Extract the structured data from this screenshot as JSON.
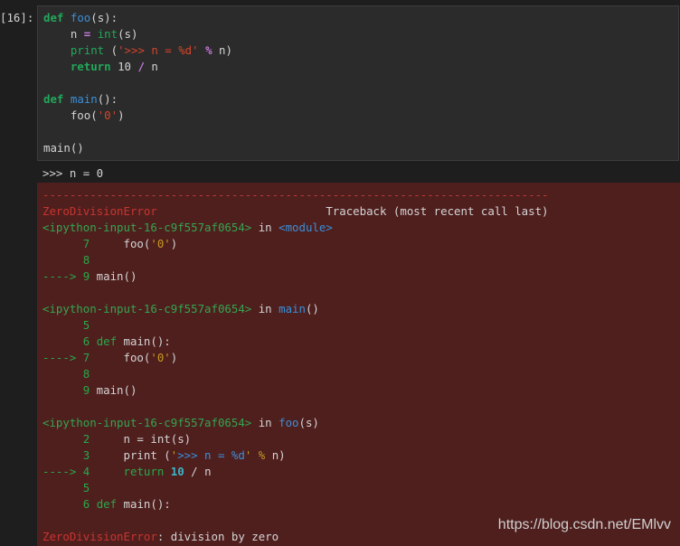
{
  "cell": {
    "prompt": "[16]:",
    "code": [
      [
        [
          "kw",
          "def"
        ],
        [
          "nm",
          " "
        ],
        [
          "fn",
          "foo"
        ],
        [
          "nm",
          "(s):"
        ]
      ],
      [
        [
          "nm",
          "    n "
        ],
        [
          "op",
          "="
        ],
        [
          "nm",
          " "
        ],
        [
          "bi",
          "int"
        ],
        [
          "nm",
          "(s)"
        ]
      ],
      [
        [
          "nm",
          "    "
        ],
        [
          "bi",
          "print"
        ],
        [
          "nm",
          " ("
        ],
        [
          "str",
          "'>>> n = "
        ],
        [
          "fmt",
          "%d"
        ],
        [
          "str",
          "'"
        ],
        [
          "nm",
          " "
        ],
        [
          "op",
          "%"
        ],
        [
          "nm",
          " n)"
        ]
      ],
      [
        [
          "nm",
          "    "
        ],
        [
          "kw",
          "return"
        ],
        [
          "nm",
          " "
        ],
        [
          "num",
          "10"
        ],
        [
          "nm",
          " "
        ],
        [
          "op",
          "/"
        ],
        [
          "nm",
          " n"
        ]
      ],
      [
        [
          "nm",
          ""
        ]
      ],
      [
        [
          "kw",
          "def"
        ],
        [
          "nm",
          " "
        ],
        [
          "fn",
          "main"
        ],
        [
          "nm",
          "():"
        ]
      ],
      [
        [
          "nm",
          "    foo("
        ],
        [
          "str",
          "'0'"
        ],
        [
          "nm",
          ")"
        ]
      ],
      [
        [
          "nm",
          ""
        ]
      ],
      [
        [
          "nm",
          "main()"
        ]
      ]
    ]
  },
  "stdout": ">>> n = 0",
  "traceback": {
    "lines": [
      [
        [
          "dash",
          "---------------------------------------------------------------------------"
        ]
      ],
      [
        [
          "err",
          "ZeroDivisionError"
        ],
        [
          "nm",
          "                         Traceback (most recent call last)"
        ]
      ],
      [
        [
          "grn",
          "<ipython-input-16-c9f557af0654>"
        ],
        [
          "nm",
          " in "
        ],
        [
          "cyn",
          "<module>"
        ]
      ],
      [
        [
          "lno",
          "      7"
        ],
        [
          "nm",
          "     foo("
        ],
        [
          "tbstr",
          "'0'"
        ],
        [
          "nm",
          ")"
        ]
      ],
      [
        [
          "lno",
          "      8"
        ]
      ],
      [
        [
          "arrow",
          "----> 9"
        ],
        [
          "nm",
          " main()"
        ]
      ],
      [
        [
          "nm",
          ""
        ]
      ],
      [
        [
          "grn",
          "<ipython-input-16-c9f557af0654>"
        ],
        [
          "nm",
          " in "
        ],
        [
          "cyn",
          "main"
        ],
        [
          "nm",
          "()"
        ]
      ],
      [
        [
          "lno",
          "      5"
        ]
      ],
      [
        [
          "lno",
          "      6"
        ],
        [
          "nm",
          " "
        ],
        [
          "tbkw",
          "def"
        ],
        [
          "nm",
          " main():"
        ]
      ],
      [
        [
          "arrow",
          "----> 7"
        ],
        [
          "nm",
          "     foo("
        ],
        [
          "tbstr",
          "'0'"
        ],
        [
          "nm",
          ")"
        ]
      ],
      [
        [
          "lno",
          "      8"
        ]
      ],
      [
        [
          "lno",
          "      9"
        ],
        [
          "nm",
          " main()"
        ]
      ],
      [
        [
          "nm",
          ""
        ]
      ],
      [
        [
          "grn",
          "<ipython-input-16-c9f557af0654>"
        ],
        [
          "nm",
          " in "
        ],
        [
          "cyn",
          "foo"
        ],
        [
          "nm",
          "(s)"
        ]
      ],
      [
        [
          "lno",
          "      2"
        ],
        [
          "nm",
          "     n = int(s)"
        ]
      ],
      [
        [
          "lno",
          "      3"
        ],
        [
          "nm",
          "     print ("
        ],
        [
          "tbstr",
          "'"
        ],
        [
          "tbstr2",
          ">>> n = %d"
        ],
        [
          "tbstr",
          "'"
        ],
        [
          "nm",
          " "
        ],
        [
          "yel",
          "%"
        ],
        [
          "nm",
          " n)"
        ]
      ],
      [
        [
          "arrow",
          "----> 4"
        ],
        [
          "nm",
          "     "
        ],
        [
          "tbkw",
          "return"
        ],
        [
          "nm",
          " "
        ],
        [
          "tbnum",
          "10"
        ],
        [
          "nm",
          " / n"
        ]
      ],
      [
        [
          "lno",
          "      5"
        ]
      ],
      [
        [
          "lno",
          "      6"
        ],
        [
          "nm",
          " "
        ],
        [
          "tbkw",
          "def"
        ],
        [
          "nm",
          " main():"
        ]
      ],
      [
        [
          "nm",
          ""
        ]
      ],
      [
        [
          "err",
          "ZeroDivisionError"
        ],
        [
          "nm",
          ": division by zero"
        ]
      ]
    ]
  },
  "watermark": "https://blog.csdn.net/EMlvv"
}
